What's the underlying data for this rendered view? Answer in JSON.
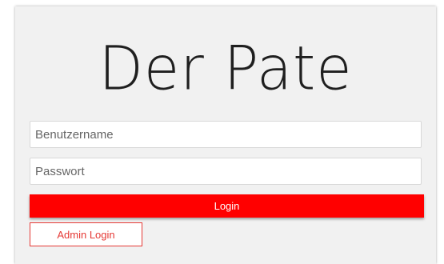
{
  "title": "Der Pate",
  "form": {
    "username_placeholder": "Benutzername",
    "password_placeholder": "Passwort",
    "username_value": "",
    "password_value": "",
    "login_label": "Login",
    "admin_login_label": "Admin Login"
  },
  "colors": {
    "accent": "#ff0000",
    "admin_border": "#e53935",
    "card_background": "#f1f1f1"
  }
}
